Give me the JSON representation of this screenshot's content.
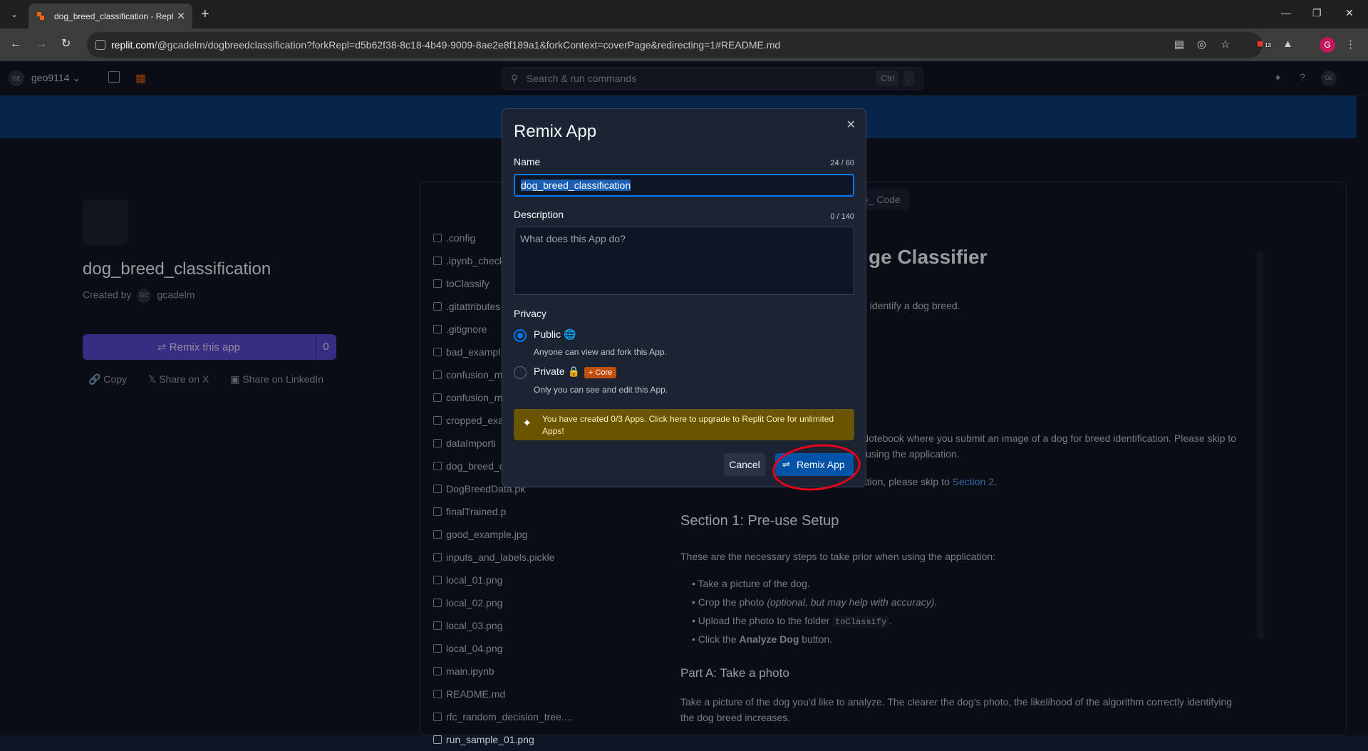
{
  "browser": {
    "tab_title": "dog_breed_classification - Repl",
    "url_host": "replit.com",
    "url_path": "/@gcadelm/dogbreedclassification?forkRepl=d5b62f38-8c18-4b49-9009-8ae2e8f189a1&forkContext=coverPage&redirecting=1#README.md",
    "ext_badge": "13",
    "profile_initial": "G"
  },
  "topbar": {
    "workspace": "geo9114",
    "workspace_initials": "GE",
    "search_placeholder": "Search & run commands",
    "kbd1": "Ctrl",
    "kbd2": ".",
    "user_initials": "GE"
  },
  "project": {
    "title": "dog_breed_classification",
    "created_by_label": "Created by",
    "author": "gcadelm",
    "author_initials": "GC",
    "remix_button": "Remix this app",
    "remix_count": "0",
    "share": {
      "copy": "Copy",
      "x": "Share on X",
      "linkedin": "Share on LinkedIn"
    }
  },
  "files": [
    ".config",
    ".ipynb_check",
    "toClassify",
    ".gitattributes",
    ".gitignore",
    "bad_exampl",
    "confusion_m",
    "confusion_m",
    "cropped_exa",
    "dataImporti",
    "dog_breed_c",
    "DogBreedData.pk",
    "finalTrained.p",
    "good_example.jpg",
    "inputs_and_labels.pickle",
    "local_01.png",
    "local_02.png",
    "local_03.png",
    "local_04.png",
    "main.ipynb",
    "README.md",
    "rfc_random_decision_tree....",
    "run_sample_01.png"
  ],
  "code_tab": "Code",
  "readme": {
    "title_fragment": "ge Classifier",
    "intro_fragment": "o identify a dog breed.",
    "notebook_fragment": "Notebook where you submit an image of a dog for breed identification. Please skip to",
    "using_fragment": "using the application.",
    "skip_fragment": "ation, please skip to",
    "section2_link": "Section 2",
    "section1": "Section 1: Pre-use Setup",
    "steps_intro": "These are the necessary steps to take prior when using the application:",
    "steps": [
      "Take a picture of the dog.",
      "Crop the photo",
      "Upload the photo to the folder",
      "Click the"
    ],
    "crop_note": "(optional, but may help with accuracy).",
    "folder_code": "toClassify",
    "analyze_label": "Analyze Dog",
    "button_word": "button.",
    "partA": "Part A: Take a photo",
    "partA_text": "Take a picture of the dog you'd like to analyze. The clearer the dog's photo, the likelihood of the algorithm correctly identifying the dog breed increases."
  },
  "modal": {
    "title": "Remix App",
    "name_label": "Name",
    "name_count": "24 / 60",
    "name_value": "dog_breed_classification",
    "desc_label": "Description",
    "desc_count": "0 / 140",
    "desc_placeholder": "What does this App do?",
    "privacy_label": "Privacy",
    "public_label": "Public",
    "public_sub": "Anyone can view and fork this App.",
    "private_label": "Private",
    "core_badge": "Core",
    "private_sub": "Only you can see and edit this App.",
    "upsell": "You have created 0/3 Apps. Click here to upgrade to Replit Core for unlimited Apps!",
    "cancel": "Cancel",
    "remix": "Remix App",
    "selected_privacy": "Public"
  }
}
